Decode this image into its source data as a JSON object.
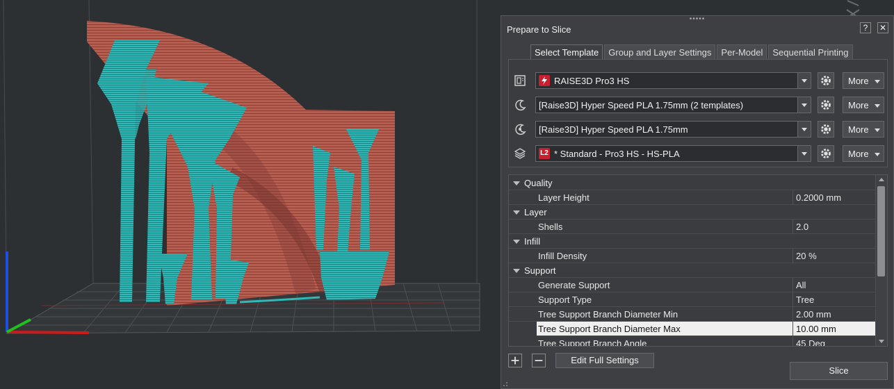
{
  "panel": {
    "title": "Prepare to Slice",
    "help_label": "?",
    "close_label": "✕",
    "tabs": [
      {
        "label": "Select Template",
        "active": true
      },
      {
        "label": "Group and Layer Settings",
        "active": false
      },
      {
        "label": "Per-Model",
        "active": false
      },
      {
        "label": "Sequential Printing",
        "active": false
      }
    ],
    "templates": [
      {
        "icon": "printer-icon",
        "value": "RAISE3D Pro3 HS",
        "badge": "",
        "more": "More"
      },
      {
        "icon": "filament-left-icon",
        "value": "[Raise3D] Hyper Speed PLA 1.75mm (2 templates)",
        "badge": "",
        "more": "More"
      },
      {
        "icon": "filament-right-icon",
        "value": "[Raise3D] Hyper Speed PLA 1.75mm",
        "badge": "",
        "more": "More"
      },
      {
        "icon": "layers-icon",
        "value": "* Standard - Pro3 HS - HS-PLA",
        "badge": "L2",
        "more": "More"
      }
    ],
    "settings": [
      {
        "type": "group",
        "label": "Quality"
      },
      {
        "type": "item",
        "label": "Layer Height",
        "value": "0.2000 mm"
      },
      {
        "type": "group",
        "label": "Layer"
      },
      {
        "type": "item",
        "label": "Shells",
        "value": "2.0"
      },
      {
        "type": "group",
        "label": "Infill"
      },
      {
        "type": "item",
        "label": "Infill Density",
        "value": "20 %"
      },
      {
        "type": "group",
        "label": "Support"
      },
      {
        "type": "item",
        "label": "Generate Support",
        "value": "All"
      },
      {
        "type": "item",
        "label": "Support Type",
        "value": "Tree"
      },
      {
        "type": "item",
        "label": "Tree Support Branch Diameter Min",
        "value": "2.00 mm"
      },
      {
        "type": "item",
        "label": "Tree Support Branch Diameter Max",
        "value": "10.00 mm",
        "selected": true
      },
      {
        "type": "item",
        "label": "Tree Support Branch Angle",
        "value": "45 Deg"
      }
    ],
    "edit_full_settings_label": "Edit Full Settings",
    "slice_label": "Slice"
  },
  "colors": {
    "model": "#b65a4f",
    "support": "#2fb7b5",
    "panel_bg": "#3d3f42",
    "badge_red": "#c8202f"
  }
}
